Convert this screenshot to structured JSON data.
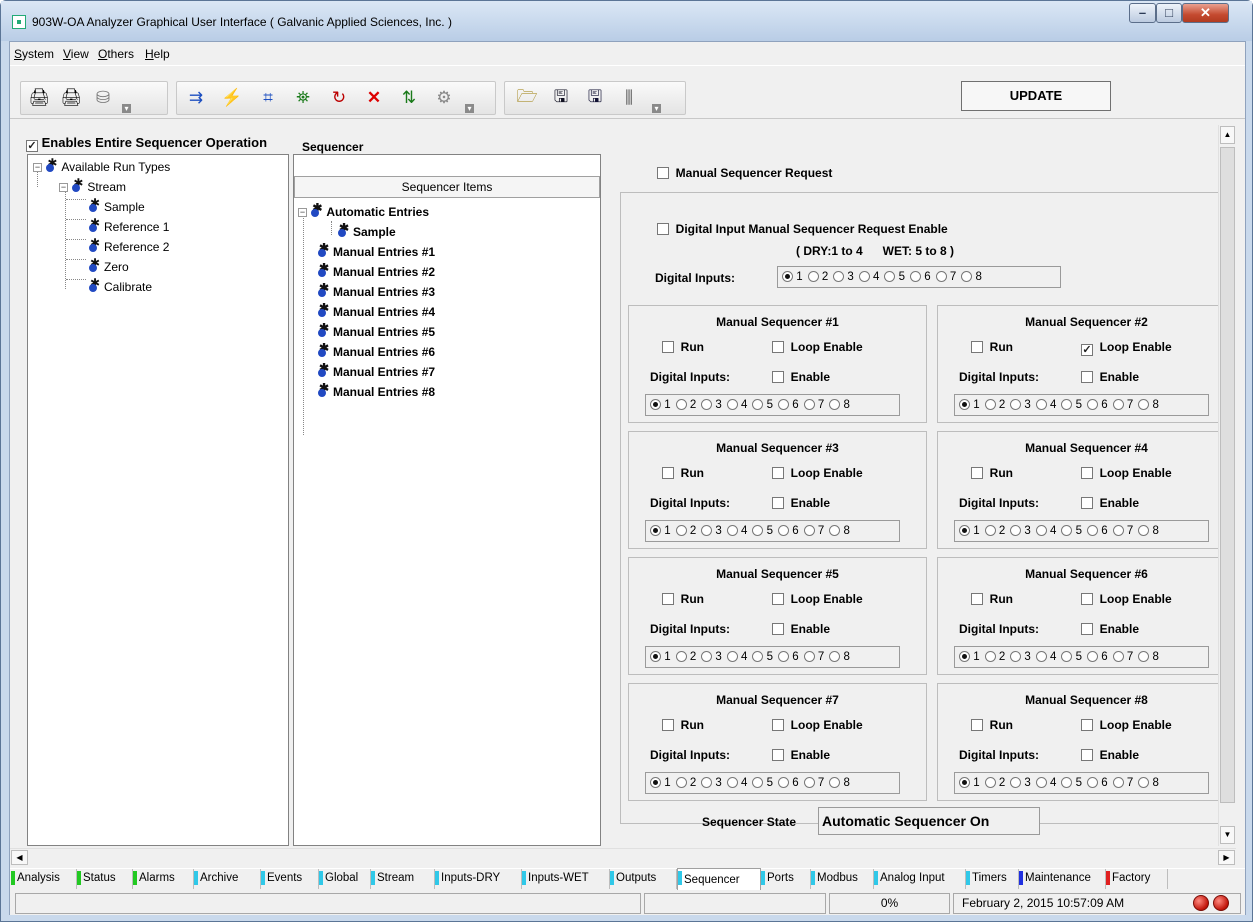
{
  "window": {
    "title": "903W-OA Analyzer Graphical User Interface  ( Galvanic Applied Sciences, Inc. )",
    "min_icon": "minimize-icon",
    "max_icon": "maximize-icon",
    "close_icon": "close-icon"
  },
  "menu": {
    "items": [
      "System",
      "View",
      "Others",
      "Help"
    ]
  },
  "toolbar": {
    "update_label": "UPDATE",
    "icons": [
      "printer-icon",
      "printer-color-icon",
      "drive-icon",
      "sample-flow-icon",
      "calibrate-icon",
      "stream-icon",
      "valve-icon",
      "run-icon",
      "stop-icon",
      "relay-icon",
      "comm-icon",
      "open-folder-icon",
      "save-icon",
      "save-as-icon",
      "column-icon"
    ]
  },
  "main": {
    "enables_label": "Enables Entire Sequencer Operation",
    "enables_checked": true,
    "run_tree": {
      "root": "Available Run Types",
      "stream": "Stream",
      "items": [
        "Sample",
        "Reference 1",
        "Reference 2",
        "Zero",
        "Calibrate"
      ]
    },
    "sequencer": {
      "label": "Sequencer",
      "header": "Sequencer Items",
      "automatic": "Automatic Entries",
      "automatic_child": "Sample",
      "manual": [
        "Manual Entries #1",
        "Manual Entries #2",
        "Manual Entries #3",
        "Manual Entries #4",
        "Manual Entries #5",
        "Manual Entries #6",
        "Manual Entries #7",
        "Manual Entries #8"
      ]
    },
    "manual_request": {
      "label": "Manual Sequencer Request",
      "checked": false
    },
    "digital_request": {
      "label": "Digital Input Manual Sequencer Request Enable",
      "range": "( DRY:1 to 4      WET: 5 to 8 )",
      "di_label": "Digital Inputs:",
      "selected": 1
    },
    "radio_options": [
      "1",
      "2",
      "3",
      "4",
      "5",
      "6",
      "7",
      "8"
    ],
    "sequencers": [
      {
        "title": "Manual Sequencer #1",
        "run": "Run",
        "loop": "Loop Enable",
        "loop_checked": false,
        "di": "Digital Inputs:",
        "enable": "Enable",
        "selected": 1
      },
      {
        "title": "Manual Sequencer #2",
        "run": "Run",
        "loop": "Loop Enable",
        "loop_checked": true,
        "di": "Digital Inputs:",
        "enable": "Enable",
        "selected": 1
      },
      {
        "title": "Manual Sequencer #3",
        "run": "Run",
        "loop": "Loop Enable",
        "loop_checked": false,
        "di": "Digital Inputs:",
        "enable": "Enable",
        "selected": 1
      },
      {
        "title": "Manual Sequencer #4",
        "run": "Run",
        "loop": "Loop Enable",
        "loop_checked": false,
        "di": "Digital Inputs:",
        "enable": "Enable",
        "selected": 1
      },
      {
        "title": "Manual Sequencer #5",
        "run": "Run",
        "loop": "Loop Enable",
        "loop_checked": false,
        "di": "Digital Inputs:",
        "enable": "Enable",
        "selected": 1
      },
      {
        "title": "Manual Sequencer #6",
        "run": "Run",
        "loop": "Loop Enable",
        "loop_checked": false,
        "di": "Digital Inputs:",
        "enable": "Enable",
        "selected": 1
      },
      {
        "title": "Manual Sequencer #7",
        "run": "Run",
        "loop": "Loop Enable",
        "loop_checked": false,
        "di": "Digital Inputs:",
        "enable": "Enable",
        "selected": 1
      },
      {
        "title": "Manual Sequencer #8",
        "run": "Run",
        "loop": "Loop Enable",
        "loop_checked": false,
        "di": "Digital Inputs:",
        "enable": "Enable",
        "selected": 1
      }
    ],
    "state_label": "Sequencer State",
    "state_value": "Automatic Sequencer On"
  },
  "tabs": [
    {
      "label": "Analysis",
      "color": "#22c922"
    },
    {
      "label": "Status",
      "color": "#22c922"
    },
    {
      "label": "Alarms",
      "color": "#22c922"
    },
    {
      "label": "Archive",
      "color": "#30c8e8"
    },
    {
      "label": "Events",
      "color": "#30c8e8"
    },
    {
      "label": "Global",
      "color": "#30c8e8"
    },
    {
      "label": "Stream",
      "color": "#30c8e8"
    },
    {
      "label": "Inputs-DRY",
      "color": "#30c8e8"
    },
    {
      "label": "Inputs-WET",
      "color": "#30c8e8"
    },
    {
      "label": "Outputs",
      "color": "#30c8e8"
    },
    {
      "label": "Sequencer",
      "color": "#30c8e8",
      "active": true
    },
    {
      "label": "Ports",
      "color": "#30c8e8"
    },
    {
      "label": "Modbus",
      "color": "#30c8e8"
    },
    {
      "label": "Analog Input",
      "color": "#30c8e8"
    },
    {
      "label": "Timers",
      "color": "#30c8e8"
    },
    {
      "label": "Maintenance",
      "color": "#2030e0"
    },
    {
      "label": "Factory",
      "color": "#e02020"
    }
  ],
  "status": {
    "progress": "0%",
    "datetime": "February 2, 2015 10:57:09 AM",
    "led_icons": [
      "status-led-icon",
      "fault-led-icon"
    ]
  }
}
